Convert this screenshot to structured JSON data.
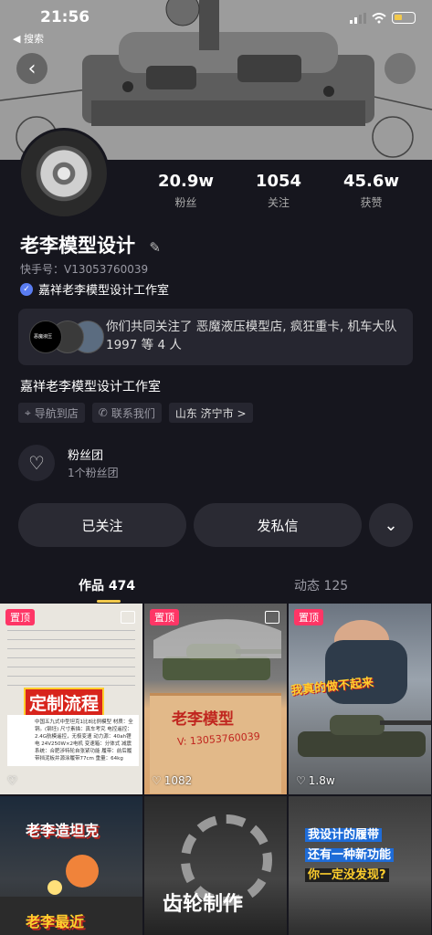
{
  "status_bar": {
    "time": "21:56",
    "back_label": "◀ 搜索"
  },
  "profile": {
    "stats": [
      {
        "value": "20.9w",
        "label": "粉丝"
      },
      {
        "value": "1054",
        "label": "关注"
      },
      {
        "value": "45.6w",
        "label": "获赞"
      }
    ],
    "name": "老李模型设计",
    "uid": "快手号：V13053760039",
    "verified": "嘉祥老李模型设计工作室",
    "mutual_follow": "你们共同关注了 恶魔液压模型店, 疯狂重卡, 机车大队1997 等 4 人",
    "mutual_avatar_text": "恶魔液压",
    "bio": "嘉祥老李模型设计工作室",
    "tags": [
      {
        "icon": "location-pin-icon",
        "label": "导航到店"
      },
      {
        "icon": "phone-icon",
        "label": "联系我们"
      },
      {
        "icon": "",
        "label": "山东 济宁市 >"
      }
    ],
    "fan_group": {
      "title": "粉丝团",
      "subtitle": "1个粉丝团"
    }
  },
  "actions": {
    "follow_label": "已关注",
    "message_label": "发私信",
    "more_label": "⌄"
  },
  "tabs": [
    {
      "label": "作品 474",
      "active": true
    },
    {
      "label": "动态 125",
      "active": false
    }
  ],
  "grid": [
    {
      "pinned": "置顶",
      "title": "定制流程",
      "likes": "",
      "spec": "中国五九式中型坦克1比8比例模型 材质：全铜。(钢坯) 尺寸素描：真车考究 电控遥控：2.4G航模遥控，无极变速 动力源：40ah锂电 24V250W×2电机 变速箱：分体式 减震系统：合肥涉特轮自张紧功能 履带：前后履带挡泥板并源涂履带77cm 重量：64kg"
    },
    {
      "pinned": "置顶",
      "title": "老李模型",
      "subtitle": "V: 13053760039",
      "likes": "1082"
    },
    {
      "pinned": "置顶",
      "title": "我真的做不起来",
      "likes": "1.8w"
    },
    {
      "pinned": "",
      "title": "老李造坦克",
      "subtitle": "老李最近",
      "likes": ""
    },
    {
      "pinned": "",
      "title": "齿轮制作",
      "likes": ""
    },
    {
      "pinned": "",
      "title_line1": "我设计的履带",
      "title_line2": "还有一种新功能",
      "title_line3": "你一定没发现?",
      "likes": ""
    }
  ],
  "colors": {
    "accent": "#f2c94c",
    "pin": "#fe3666",
    "bg": "#16161e",
    "card": "#262630"
  }
}
